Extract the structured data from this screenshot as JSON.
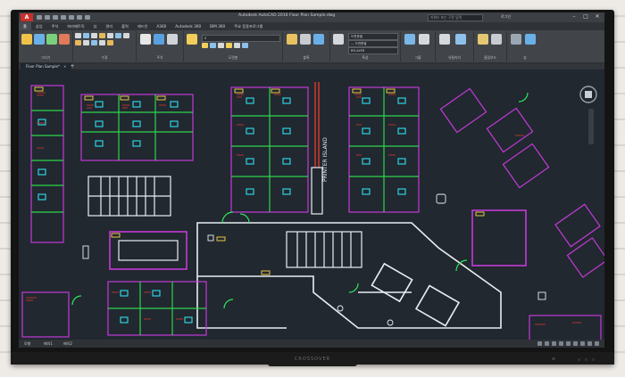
{
  "app": {
    "logo_text": "A",
    "window_title": "Autodesk AutoCAD 2016   Floor Plan Sample.dwg",
    "search_placeholder": "키워드 또는 구문 입력",
    "signin_text": "로그인",
    "window_controls": [
      "–",
      "□",
      "✕"
    ]
  },
  "ribbon": {
    "tabs": [
      "홈",
      "삽입",
      "주석",
      "파라메트릭",
      "뷰",
      "관리",
      "출력",
      "애드인",
      "A360",
      "Autodesk 360",
      "BIM 360",
      "주요 응용프로그램"
    ],
    "active_tab": "홈",
    "panels": [
      {
        "label": "그리기"
      },
      {
        "label": "수정"
      },
      {
        "label": "주석"
      },
      {
        "label": "도면층"
      },
      {
        "label": "블록"
      },
      {
        "label": "특성"
      },
      {
        "label": "그룹"
      },
      {
        "label": "유틸리티"
      },
      {
        "label": "클립보드"
      },
      {
        "label": "뷰"
      }
    ],
    "layer_combo": "0",
    "props_combo_1": "도면층별",
    "props_combo_2": "— 도면층별",
    "props_combo_3": "BYLAYER"
  },
  "document": {
    "tab_label": "Floor Plan Sample*",
    "close_glyph": "×",
    "new_tab_glyph": "+"
  },
  "drawing": {
    "label_printer_island": "PRINTER ISLAND",
    "colors": {
      "background": "#212830",
      "walls": "#e9eef2",
      "offices": "#c43ad8",
      "workstations": "#2fd44a",
      "chairs": "#2ed1e0",
      "text": "#e03a2c",
      "tags": "#ffd84a",
      "doors": "#2ee85a"
    }
  },
  "status": {
    "tab_model": "모형",
    "tab_layout1": "배치1",
    "tab_layout2": "배치2"
  },
  "monitor": {
    "brand": "CROSSOVER"
  }
}
